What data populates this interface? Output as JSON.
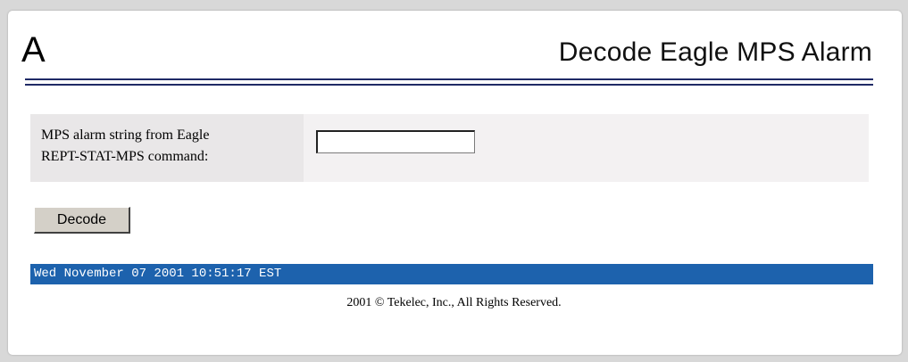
{
  "header": {
    "logo_letter": "A",
    "title": "Decode Eagle MPS Alarm"
  },
  "form": {
    "label_line1": "MPS alarm string from Eagle",
    "label_line2": "REPT-STAT-MPS command:",
    "input_value": "",
    "input_placeholder": "",
    "decode_button_label": "Decode"
  },
  "status_bar": {
    "datetime": "Wed November 07 2001 10:51:17 EST"
  },
  "footer": {
    "copyright": "2001 © Tekelec, Inc., All Rights Reserved."
  },
  "colors": {
    "status_bar_bg": "#1d62ad",
    "header_rule": "#1f2a66",
    "button_face": "#d4d0c8"
  }
}
